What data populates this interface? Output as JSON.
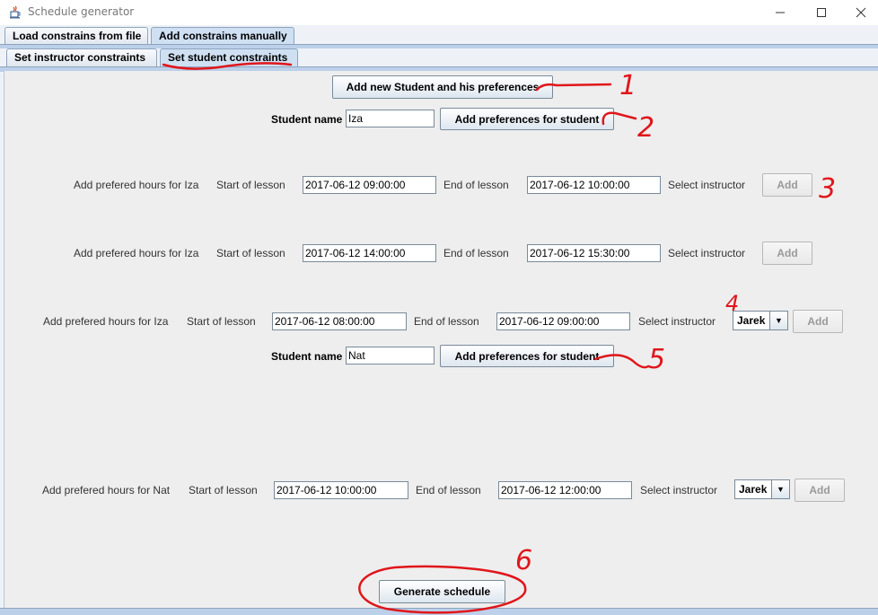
{
  "window": {
    "title": "Schedule generator",
    "minimize_icon": "minimize-icon",
    "maximize_icon": "maximize-icon",
    "close_icon": "close-icon"
  },
  "outer_tabs": [
    {
      "label": "Load constrains from file",
      "selected": false
    },
    {
      "label": "Add constrains manually",
      "selected": true
    }
  ],
  "inner_tabs": [
    {
      "label": "Set instructor constraints",
      "selected": false
    },
    {
      "label": "Set student constraints",
      "selected": true
    }
  ],
  "add_student_button": "Add new Student and his preferences",
  "labels": {
    "student_name": "Student name",
    "start": "Start of lesson",
    "end": "End of lesson",
    "select_instructor": "Select instructor",
    "add": "Add",
    "add_prefs": "Add preferences for student"
  },
  "students": [
    {
      "name": "Iza",
      "preferences": [
        {
          "label": "Add prefered hours for Iza",
          "start": "2017-06-12 09:00:00",
          "end": "2017-06-12 10:00:00",
          "instructor": ""
        },
        {
          "label": "Add prefered hours for Iza",
          "start": "2017-06-12 14:00:00",
          "end": "2017-06-12 15:30:00",
          "instructor": ""
        },
        {
          "label": "Add prefered hours for Iza",
          "start": "2017-06-12 08:00:00",
          "end": "2017-06-12 09:00:00",
          "instructor": "Jarek"
        }
      ]
    },
    {
      "name": "Nat",
      "preferences": [
        {
          "label": "Add prefered hours for Nat",
          "start": "2017-06-12 10:00:00",
          "end": "2017-06-12 12:00:00",
          "instructor": "Jarek"
        }
      ]
    }
  ],
  "generate_button": "Generate schedule",
  "annotations": {
    "color": "#e0161b",
    "numbers": [
      "1",
      "2",
      "3",
      "4",
      "5",
      "6"
    ]
  },
  "colors": {
    "tab_strip": "#bcd0ea",
    "panel": "#eeeeee"
  }
}
